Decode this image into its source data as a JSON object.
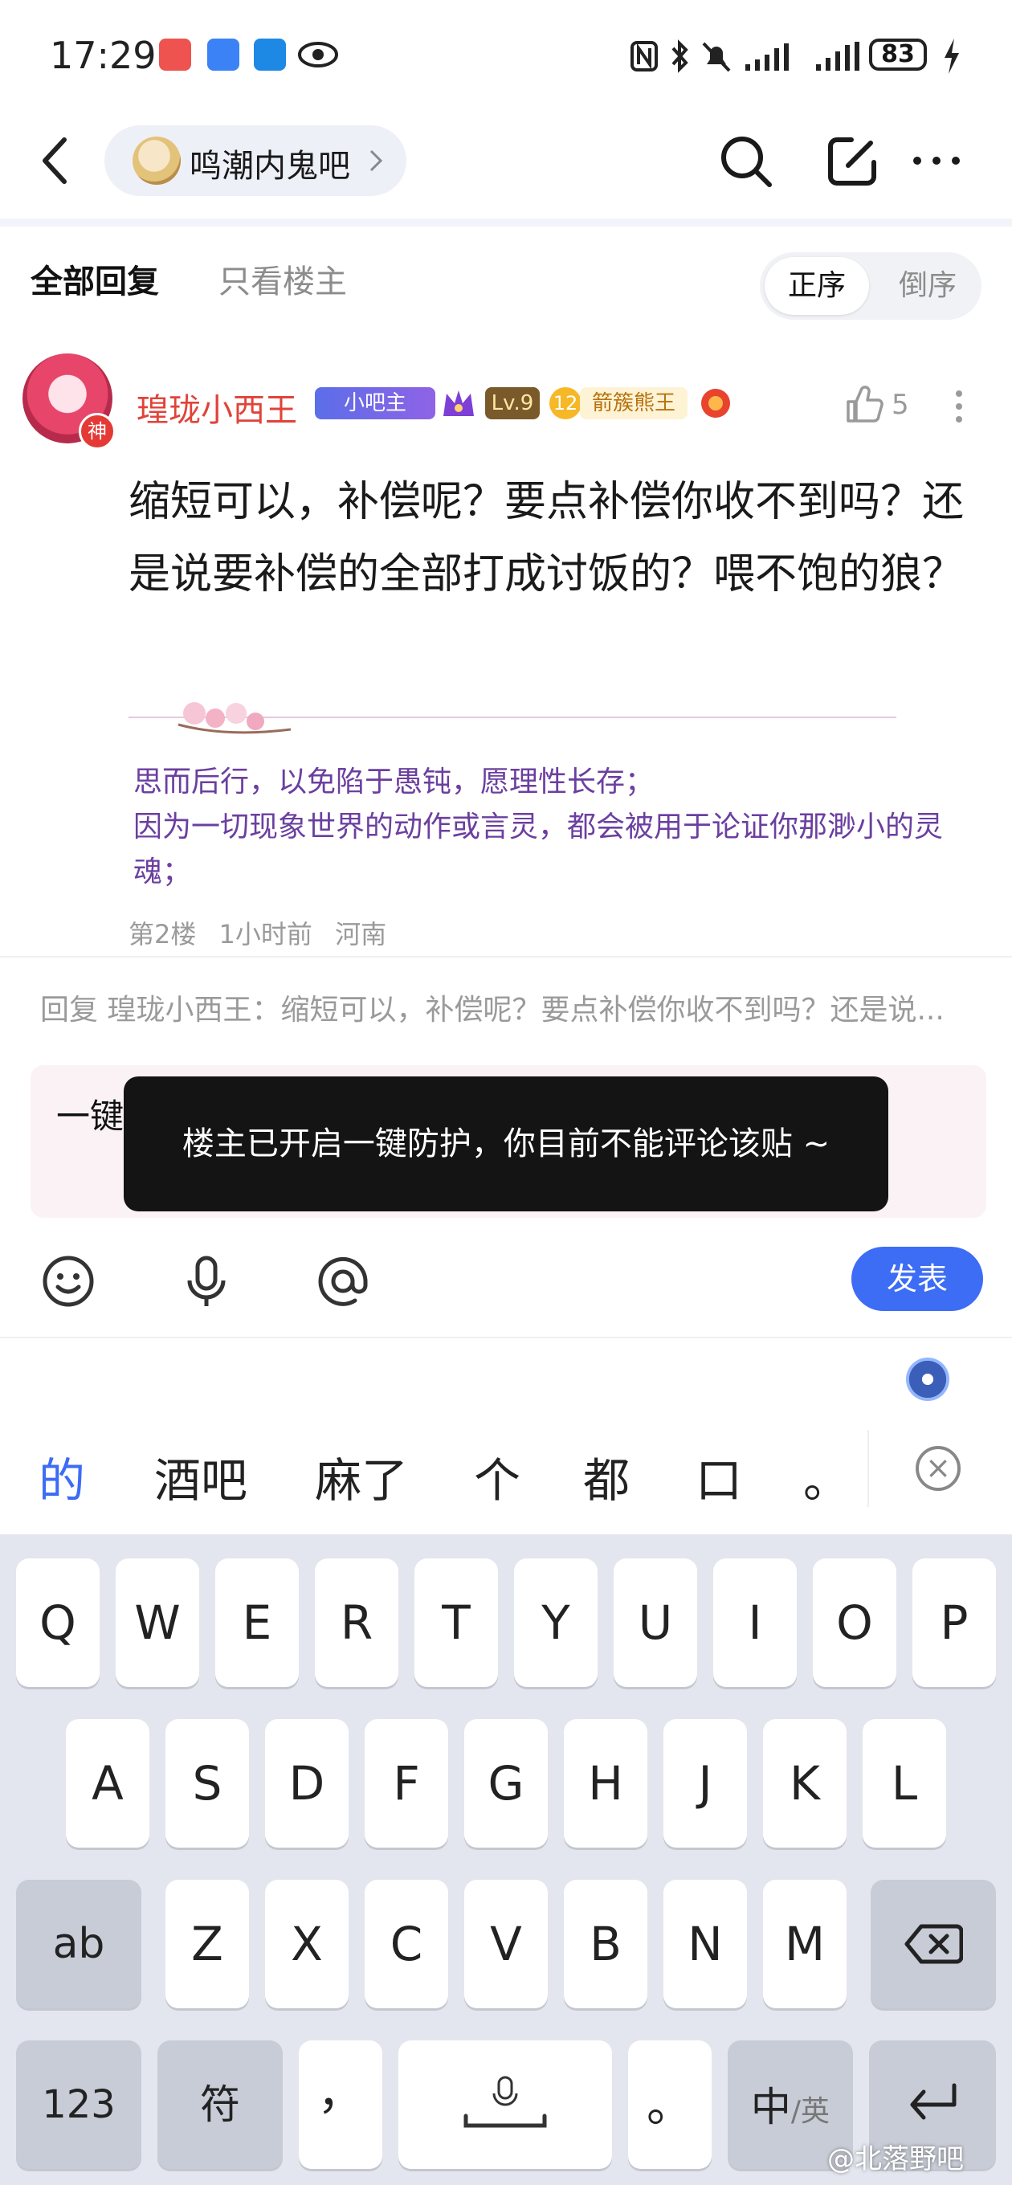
{
  "status_bar": {
    "time": "17:29",
    "battery": "83"
  },
  "nav": {
    "forum_name": "鸣潮内鬼吧"
  },
  "tabs": {
    "all_replies": "全部回复",
    "op_only": "只看楼主",
    "sort_asc": "正序",
    "sort_desc": "倒序"
  },
  "post": {
    "username": "瑝珑小西王",
    "avatar_badge": "神",
    "badges": {
      "moderator": "小吧主",
      "level": "Lv.9",
      "rank_number": "12",
      "rank_title": "箭簇熊王"
    },
    "like_count": "5",
    "content": "缩短可以，补偿呢？要点补偿你收不到吗？还是说要补偿的全部打成讨饭的？喂不饱的狼？",
    "signature": [
      "思而后行，以免陷于愚钝，愿理性长存；",
      "因为一切现象世界的动作或言灵，都会被用于论证你那渺小的灵魂；"
    ],
    "meta": {
      "floor": "第2楼",
      "time": "1小时前",
      "location": "河南"
    }
  },
  "reply": {
    "hint": "回复 瑝珑小西王：缩短可以，补偿呢？要点补偿你收不到吗？还是说...",
    "input_text": "一键防护闹麻了",
    "toast": "楼主已开启一键防护，你目前不能评论该贴 ~",
    "send_label": "发表"
  },
  "ime": {
    "candidates": [
      "的",
      "酒吧",
      "麻了",
      "个",
      "都",
      "口",
      "。"
    ],
    "row1": [
      "Q",
      "W",
      "E",
      "R",
      "T",
      "Y",
      "U",
      "I",
      "O",
      "P"
    ],
    "row2": [
      "A",
      "S",
      "D",
      "F",
      "G",
      "H",
      "J",
      "K",
      "L"
    ],
    "row3": [
      "Z",
      "X",
      "C",
      "V",
      "B",
      "N",
      "M"
    ],
    "shift_label": "ab",
    "num_label": "123",
    "symbol_label": "符",
    "comma_label": "，",
    "period_label": "。",
    "lang_label_main": "中",
    "lang_label_sub": "/英"
  },
  "watermark": "@北落野吧",
  "colors": {
    "accent_blue": "#3d6cf5",
    "username_red": "#e0433a",
    "signature_purple": "#6b3fa0",
    "toast_bg": "#141414"
  }
}
